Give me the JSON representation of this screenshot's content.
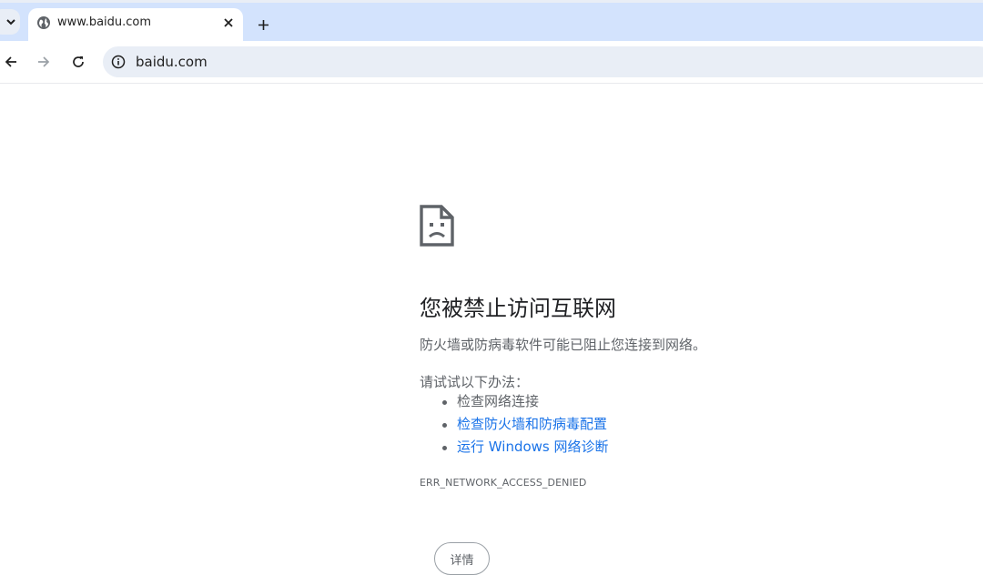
{
  "tab": {
    "title": "www.baidu.com",
    "favicon": "globe-icon"
  },
  "toolbar": {
    "url": "baidu.com"
  },
  "error": {
    "icon": "sad-file-icon",
    "title": "您被禁止访问互联网",
    "description": "防火墙或防病毒软件可能已阻止您连接到网络。",
    "try_label": "请试试以下办法：",
    "suggestions": [
      {
        "text": "检查网络连接",
        "link": false
      },
      {
        "text": "检查防火墙和防病毒配置",
        "link": true
      },
      {
        "text": "运行 Windows 网络诊断",
        "link": true
      }
    ],
    "code": "ERR_NETWORK_ACCESS_DENIED",
    "details_label": "详情"
  },
  "colors": {
    "tabstrip_bg": "#d3e3fd",
    "omnibox_bg": "#e9eef6",
    "link": "#1a73e8",
    "secondary_text": "#5f6368"
  }
}
